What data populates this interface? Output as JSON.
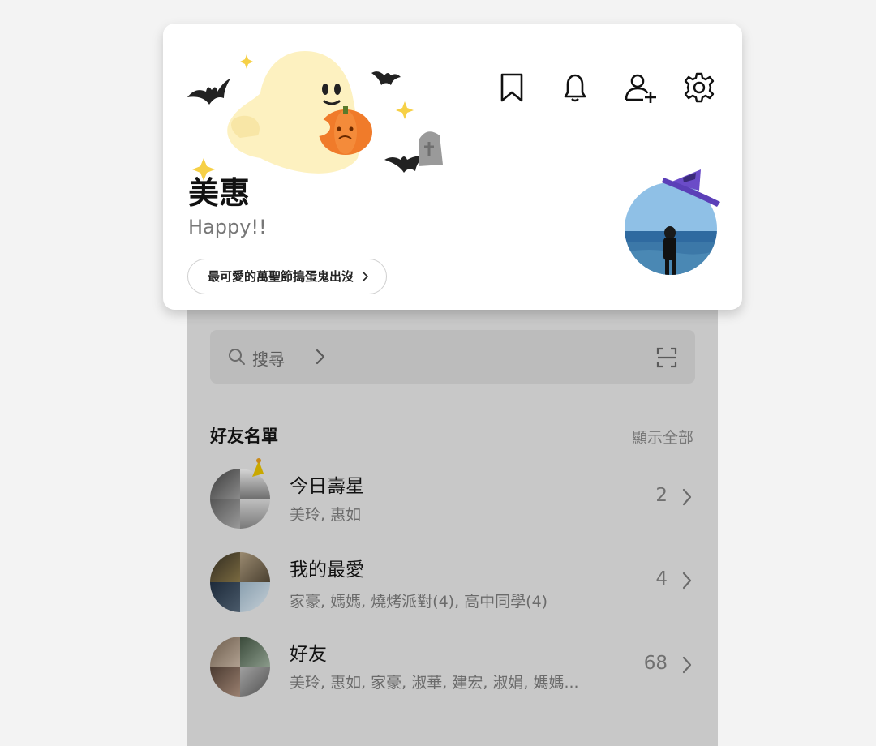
{
  "profile": {
    "name": "美惠",
    "status_message": "Happy!!",
    "music_label": "最可愛的萬聖節搗蛋鬼出沒"
  },
  "toolbar": {
    "icons": [
      "bookmark-icon",
      "bell-icon",
      "add-friend-icon",
      "gear-icon"
    ]
  },
  "search": {
    "label": "搜尋"
  },
  "friends": {
    "header": "好友名單",
    "show_all": "顯示全部",
    "groups": [
      {
        "title": "今日壽星",
        "members": "美玲, 惠如",
        "count": "2"
      },
      {
        "title": "我的最愛",
        "members": "家豪, 媽媽, 燒烤派對(4), 高中同學(4)",
        "count": "4"
      },
      {
        "title": "好友",
        "members": "美玲, 惠如, 家豪, 淑華, 建宏, 淑娟, 媽媽...",
        "count": "68"
      }
    ]
  },
  "colors": {
    "dim_background": "#c8c8c8",
    "card": "#ffffff",
    "witch_hat": "#5b3fb8"
  }
}
